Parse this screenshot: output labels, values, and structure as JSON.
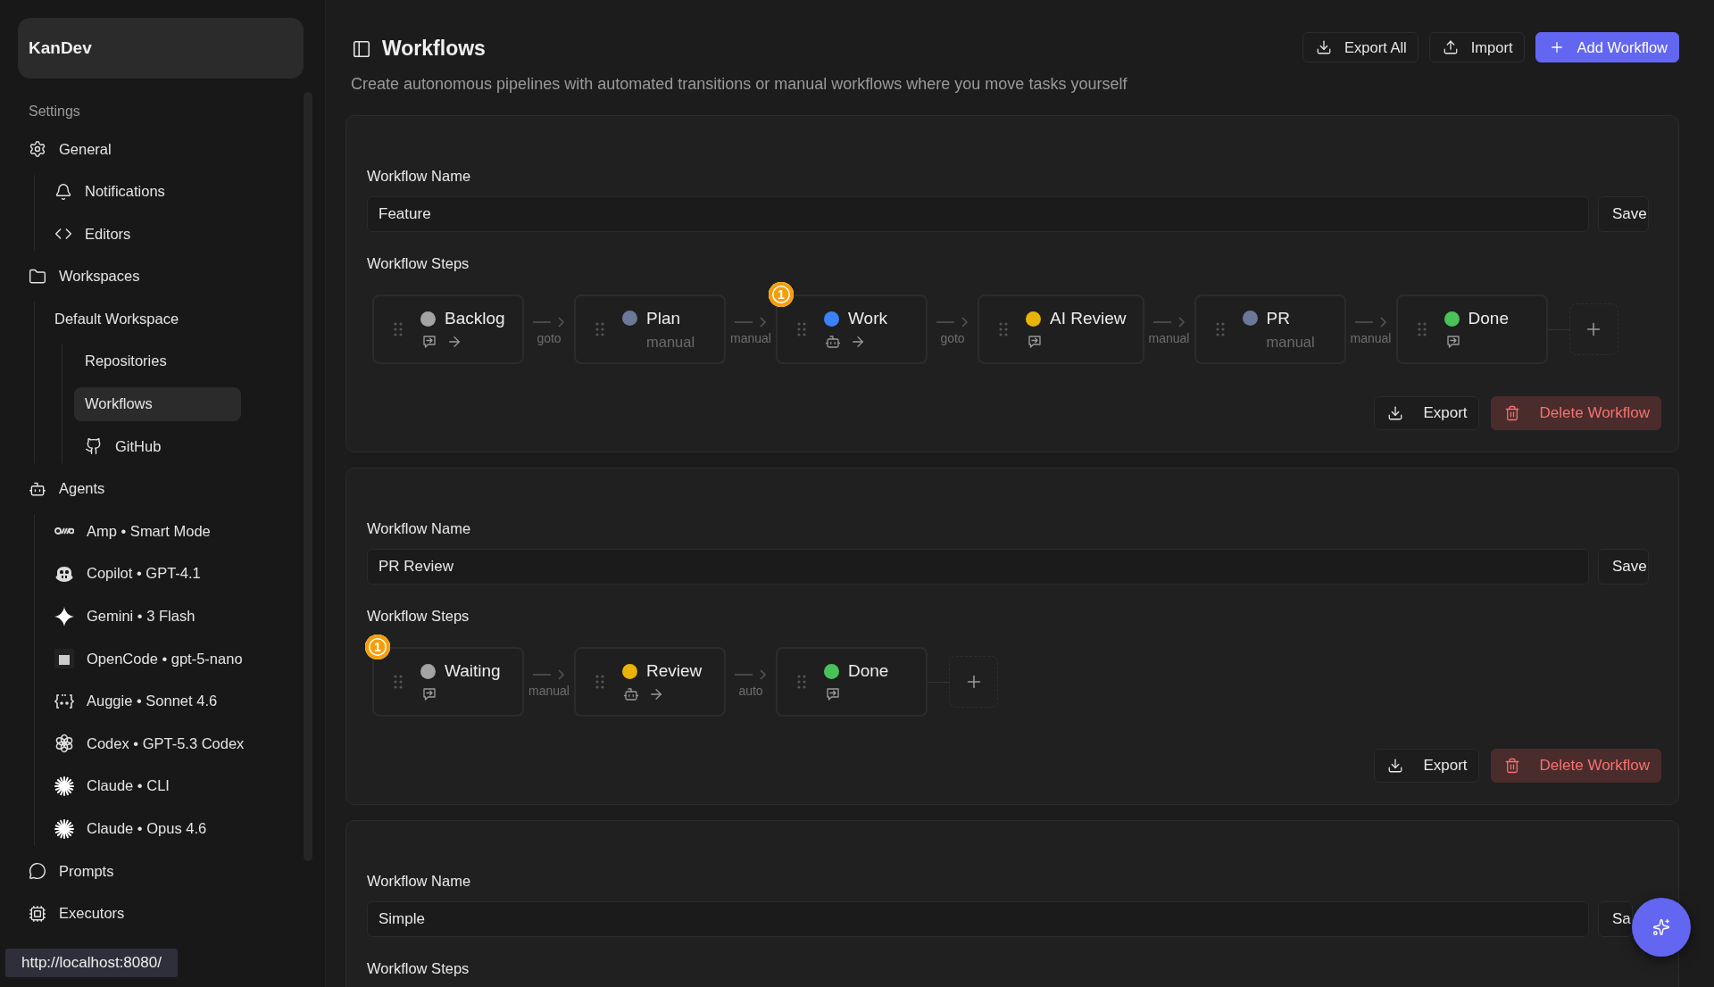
{
  "sidebar": {
    "app_name": "KanDev",
    "section_title": "Settings",
    "items": [
      {
        "label": "General",
        "selected": false,
        "children": [
          {
            "label": "Notifications",
            "selected": false
          },
          {
            "label": "Editors",
            "selected": false
          }
        ]
      },
      {
        "label": "Workspaces",
        "selected": false,
        "children": [
          {
            "label": "Default Workspace",
            "selected": false,
            "children": [
              {
                "label": "Repositories",
                "selected": false
              },
              {
                "label": "Workflows",
                "selected": true
              },
              {
                "label": "GitHub",
                "selected": false
              }
            ]
          }
        ]
      },
      {
        "label": "Agents",
        "selected": false,
        "children": [
          {
            "label": "Amp • Smart Mode",
            "selected": false
          },
          {
            "label": "Copilot • GPT-4.1",
            "selected": false
          },
          {
            "label": "Gemini • 3 Flash",
            "selected": false
          },
          {
            "label": "OpenCode • gpt-5-nano",
            "selected": false
          },
          {
            "label": "Auggie • Sonnet 4.6",
            "selected": false
          },
          {
            "label": "Codex • GPT-5.3 Codex",
            "selected": false
          },
          {
            "label": "Claude • CLI",
            "selected": false
          },
          {
            "label": "Claude • Opus 4.6",
            "selected": false
          }
        ]
      },
      {
        "label": "Prompts",
        "selected": false
      },
      {
        "label": "Executors",
        "selected": false
      }
    ],
    "status_url": "http://localhost:8080/"
  },
  "header": {
    "title": "Workflows",
    "subtitle": "Create autonomous pipelines with automated transitions or manual workflows where you move tasks yourself",
    "buttons": [
      {
        "label": "Export All",
        "kind": "export"
      },
      {
        "label": "Import",
        "kind": "import"
      },
      {
        "label": "Add Workflow",
        "kind": "add"
      }
    ]
  },
  "workflows": [
    {
      "name_label": "Workflow Name",
      "name": "Feature",
      "save": "Save",
      "steps_label": "Workflow Steps",
      "export": "Export",
      "delete": "Delete Workflow",
      "steps": [
        {
          "name": "Backlog",
          "color": "#a3a3a3",
          "actions": [
            {
              "kind": "message"
            },
            {
              "kind": "arrow"
            }
          ],
          "transition": "goto"
        },
        {
          "name": "Plan",
          "color": "#6b7898",
          "subtitle": "manual",
          "transition": "manual"
        },
        {
          "name": "Work",
          "color": "#3b82f6",
          "badge": "1",
          "actions": [
            {
              "kind": "robot"
            },
            {
              "kind": "arrow"
            }
          ],
          "transition": "goto"
        },
        {
          "name": "AI Review",
          "color": "#eab308",
          "actions": [
            {
              "kind": "message"
            }
          ],
          "transition": "manual"
        },
        {
          "name": "PR",
          "color": "#6b7898",
          "subtitle": "manual",
          "transition": "manual"
        },
        {
          "name": "Done",
          "color": "#4ac25a",
          "actions": [
            {
              "kind": "message"
            }
          ]
        }
      ]
    },
    {
      "name_label": "Workflow Name",
      "name": "PR Review",
      "save": "Save",
      "steps_label": "Workflow Steps",
      "export": "Export",
      "delete": "Delete Workflow",
      "steps": [
        {
          "name": "Waiting",
          "color": "#a3a3a3",
          "badge": "1",
          "actions": [
            {
              "kind": "message"
            }
          ],
          "transition": "manual"
        },
        {
          "name": "Review",
          "color": "#eab308",
          "actions": [
            {
              "kind": "robot"
            },
            {
              "kind": "arrow"
            }
          ],
          "transition": "auto"
        },
        {
          "name": "Done",
          "color": "#4ac25a",
          "actions": [
            {
              "kind": "message"
            }
          ]
        }
      ]
    },
    {
      "name_label": "Workflow Name",
      "name": "Simple",
      "save": "Sa",
      "steps_label": "Workflow Steps"
    }
  ]
}
